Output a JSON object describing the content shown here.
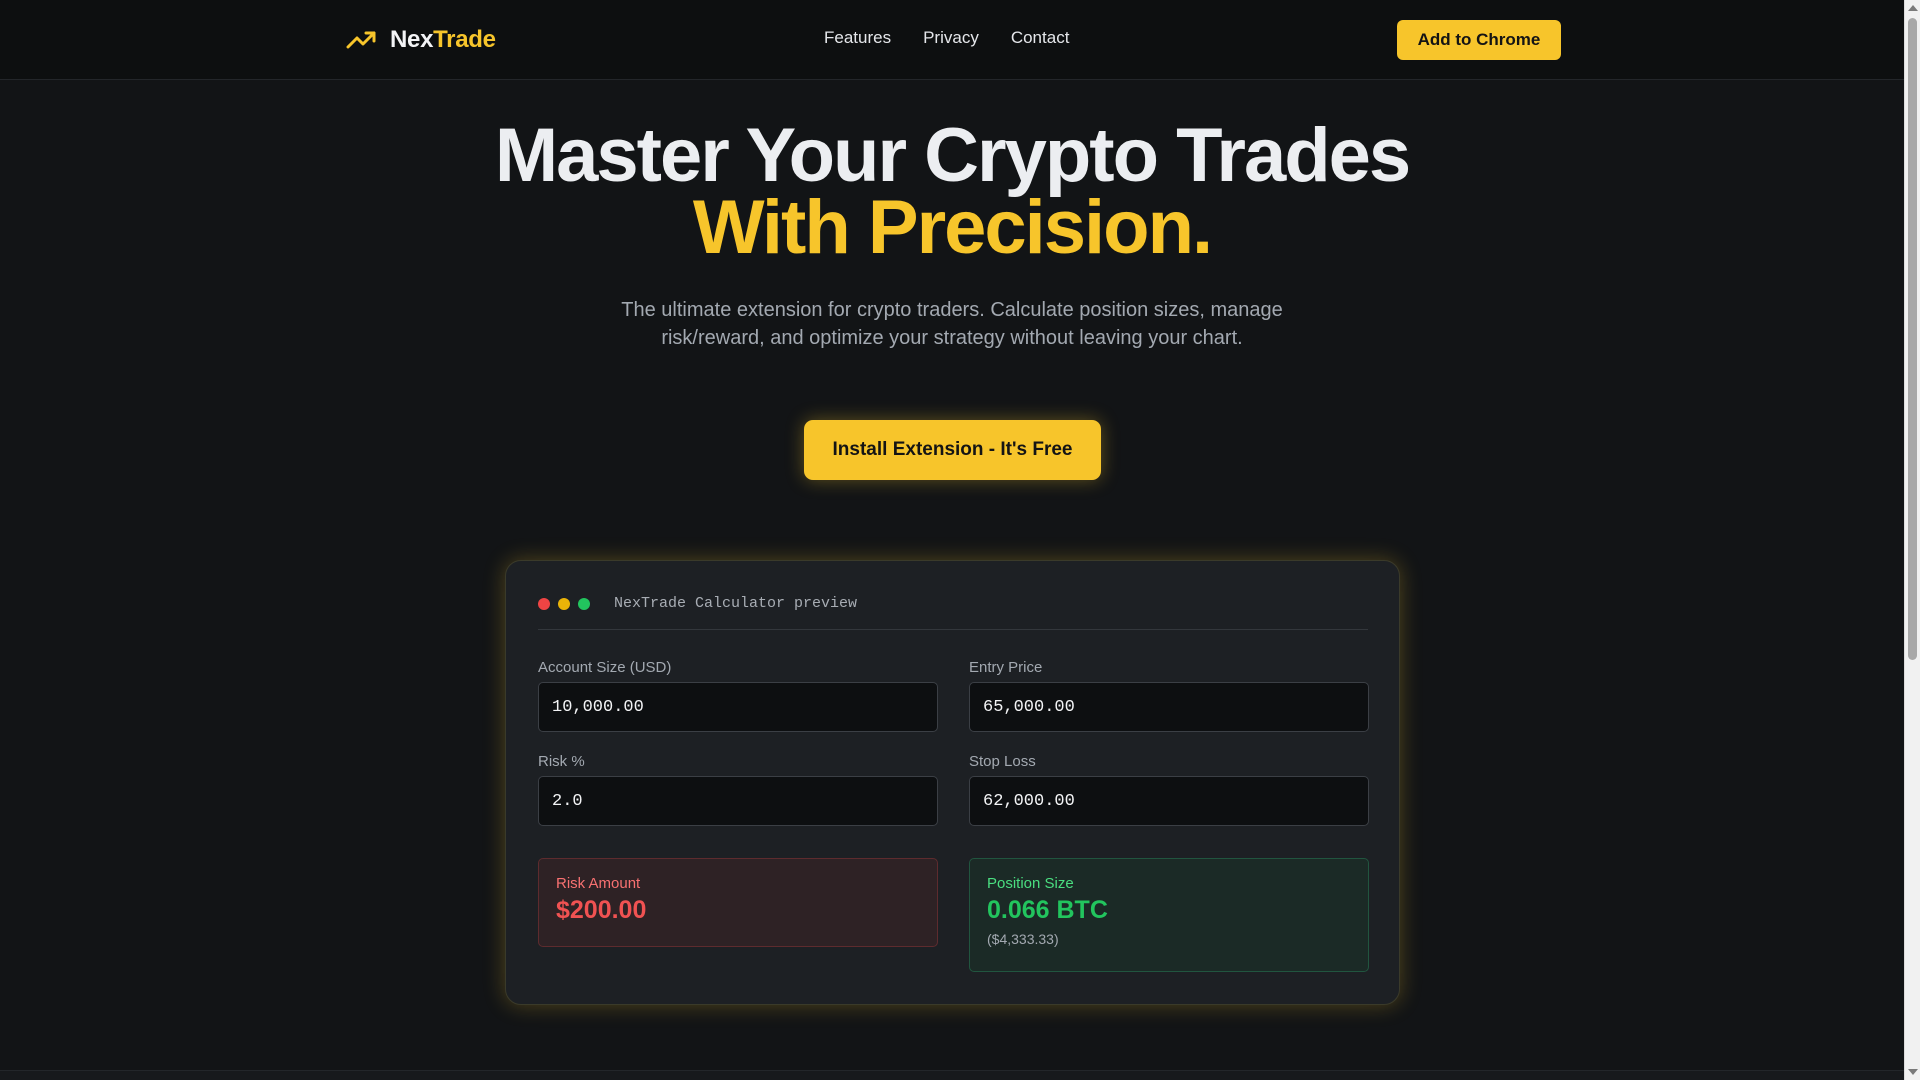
{
  "header": {
    "logo_part1": "Nex",
    "logo_part2": "Trade",
    "logo_icon": "trending-up-icon",
    "nav": [
      {
        "label": "Features"
      },
      {
        "label": "Privacy"
      },
      {
        "label": "Contact"
      }
    ],
    "cta_label": "Add to Chrome"
  },
  "hero": {
    "title_line1": "Master Your Crypto Trades",
    "title_line2": "With Precision.",
    "subtitle": "The ultimate extension for crypto traders. Calculate position sizes, manage risk/reward, and optimize your strategy without leaving your chart.",
    "install_label": "Install Extension - It's Free"
  },
  "preview": {
    "title": "NexTrade Calculator preview",
    "fields": {
      "account_size": {
        "label": "Account Size (USD)",
        "value": "10,000.00"
      },
      "entry_price": {
        "label": "Entry Price",
        "value": "65,000.00"
      },
      "risk_pct": {
        "label": "Risk %",
        "value": "2.0"
      },
      "stop_loss": {
        "label": "Stop Loss",
        "value": "62,000.00"
      }
    },
    "risk_amount": {
      "label": "Risk Amount",
      "value": "$200.00"
    },
    "position_size": {
      "label": "Position Size",
      "value": "0.066 BTC",
      "sub": "($4,333.33)"
    }
  },
  "colors": {
    "accent": "#f7c52b",
    "background": "#121416",
    "danger": "#f05252",
    "success": "#22c55e"
  }
}
